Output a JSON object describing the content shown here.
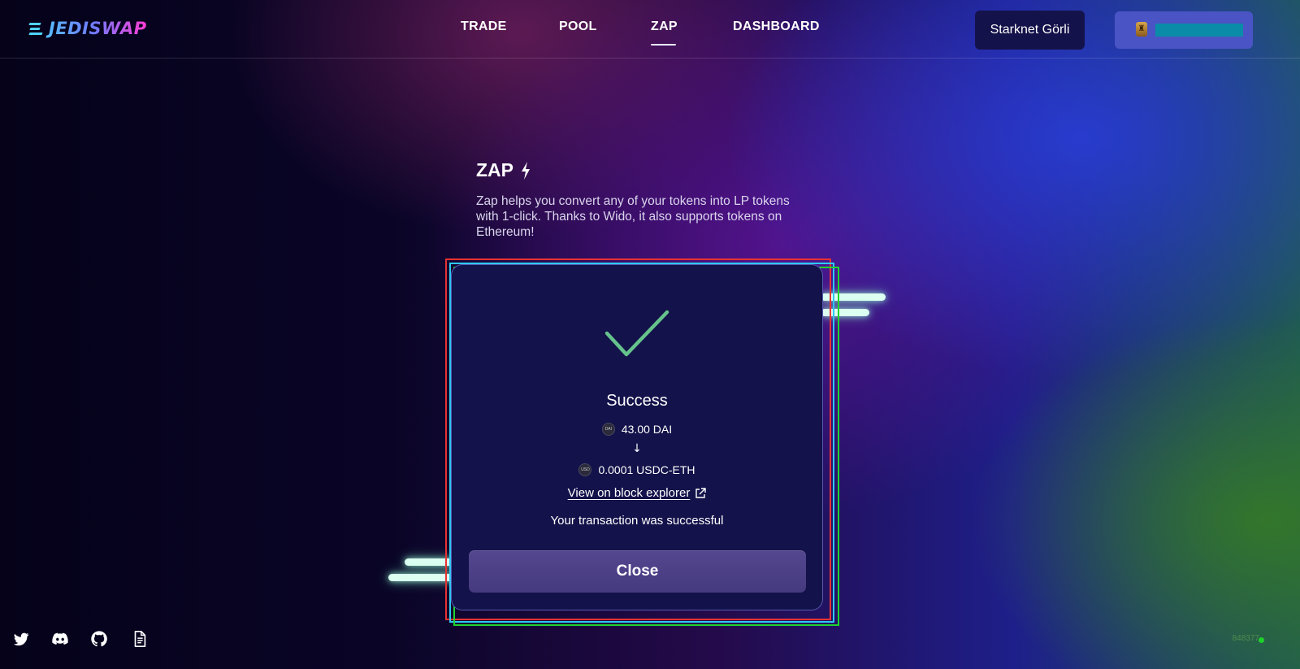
{
  "app": {
    "logo_text": "JEDISWAP"
  },
  "nav": {
    "items": [
      {
        "label": "TRADE"
      },
      {
        "label": "POOL"
      },
      {
        "label": "ZAP"
      },
      {
        "label": "DASHBOARD"
      }
    ],
    "active": "ZAP"
  },
  "header": {
    "network_label": "Starknet Görli",
    "wallet_address": ""
  },
  "hero": {
    "title": "ZAP",
    "description": "Zap helps you convert any of your tokens into LP tokens with 1-click. Thanks to Wido, it also supports tokens on Ethereum!"
  },
  "modal": {
    "title": "Success",
    "from": {
      "icon_label": "DAI",
      "amount": "43.00 DAI"
    },
    "arrow": "↓",
    "to": {
      "icon_label": "USD",
      "amount": "0.0001 USDC-ETH"
    },
    "explorer_link": "View on block explorer",
    "status_message": "Your transaction was successful",
    "close_label": "Close"
  },
  "footer": {
    "social": [
      "twitter-icon",
      "discord-icon",
      "github-icon",
      "docs-icon"
    ],
    "block_number": "848377",
    "status_color": "#1fd12a"
  },
  "colors": {
    "accent_check": "#66c28c",
    "modal_bg": "#13124a",
    "close_button": "#4c4088",
    "network_button": "#14124a",
    "wallet_button": "#4a54c4"
  }
}
